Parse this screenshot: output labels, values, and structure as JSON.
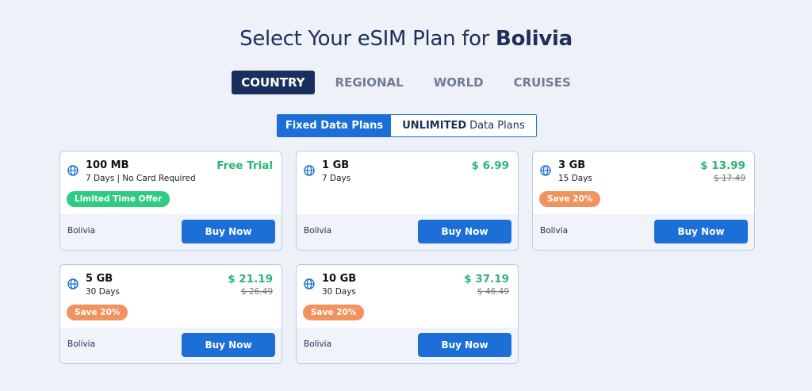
{
  "header": {
    "title_prefix": "Select Your eSIM Plan for",
    "title_country": "Bolivia"
  },
  "tabs": [
    "COUNTRY",
    "REGIONAL",
    "WORLD",
    "CRUISES"
  ],
  "active_tab": "COUNTRY",
  "plan_toggle": {
    "fixed": "Fixed Data Plans",
    "unlimited_bold": "UNLIMITED",
    "unlimited_rest": "Data Plans"
  },
  "colors": {
    "accent": "#1b6fd6",
    "navy": "#1b2f5e",
    "price_green": "#2bb673",
    "badge_green": "#2ecc80",
    "badge_orange": "#f2925e"
  },
  "plans": [
    {
      "size": "100 MB",
      "duration": "7 Days | No Card Required",
      "price": "Free Trial",
      "old_price": "",
      "badge": "Limited Time Offer",
      "country": "Bolivia",
      "button": "Buy Now",
      "icon": "globe-icon"
    },
    {
      "size": "1 GB",
      "duration": "7 Days",
      "price": "$ 6.99",
      "old_price": "",
      "badge": "",
      "country": "Bolivia",
      "button": "Buy Now",
      "icon": "globe-icon"
    },
    {
      "size": "3 GB",
      "duration": "15 Days",
      "price": "$ 13.99",
      "old_price": "$ 17.49",
      "badge": "Save 20%",
      "country": "Bolivia",
      "button": "Buy Now",
      "icon": "globe-icon"
    },
    {
      "size": "5 GB",
      "duration": "30 Days",
      "price": "$ 21.19",
      "old_price": "$ 26.49",
      "badge": "Save 20%",
      "country": "Bolivia",
      "button": "Buy Now",
      "icon": "globe-icon"
    },
    {
      "size": "10 GB",
      "duration": "30 Days",
      "price": "$ 37.19",
      "old_price": "$ 46.49",
      "badge": "Save 20%",
      "country": "Bolivia",
      "button": "Buy Now",
      "icon": "globe-icon"
    }
  ]
}
